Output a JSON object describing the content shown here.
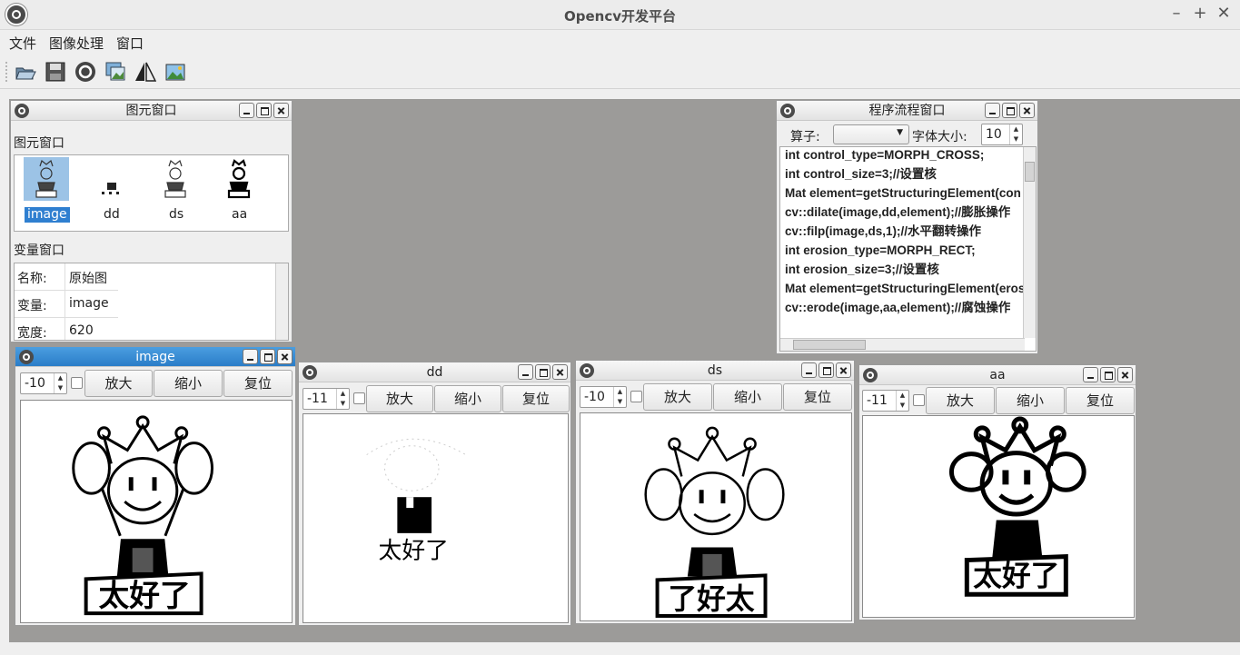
{
  "window": {
    "title": "Opencv开发平台",
    "controls": [
      "–",
      "+",
      "✕"
    ]
  },
  "menu": [
    "文件",
    "图像处理",
    "窗口"
  ],
  "toolbar": [
    "open-icon",
    "save-icon",
    "opencv-icon",
    "image-icon",
    "flip-icon",
    "picture-icon"
  ],
  "element_window": {
    "title": "图元窗口",
    "section_label": "图元窗口",
    "items": [
      {
        "label": "image",
        "selected": true
      },
      {
        "label": "dd",
        "selected": false
      },
      {
        "label": "ds",
        "selected": false
      },
      {
        "label": "aa",
        "selected": false
      }
    ],
    "var_label": "变量窗口",
    "vars": [
      {
        "key": "名称:",
        "value": "原始图"
      },
      {
        "key": "变量:",
        "value": "image"
      },
      {
        "key": "宽度:",
        "value": "620"
      }
    ]
  },
  "flow_window": {
    "title": "程序流程窗口",
    "operator_label": "算子:",
    "operator_value": "",
    "font_size_label": "字体大小:",
    "font_size_value": "10",
    "lines": [
      "int control_type=MORPH_CROSS;",
      "int control_size=3;//设置核",
      "Mat element=getStructuringElement(con",
      "cv::dilate(image,dd,element);//膨胀操作",
      "cv::filp(image,ds,1);//水平翻转操作",
      "int erosion_type=MORPH_RECT;",
      "int erosion_size=3;//设置核",
      "Mat element=getStructuringElement(eros",
      "cv::erode(image,aa,element);//腐蚀操作"
    ]
  },
  "image_windows": [
    {
      "title": "image",
      "zoom": "-10",
      "zoom_in": "放大",
      "zoom_out": "缩小",
      "reset": "复位",
      "caption": "太好了"
    },
    {
      "title": "dd",
      "zoom": "-11",
      "zoom_in": "放大",
      "zoom_out": "缩小",
      "reset": "复位",
      "caption": "太好了"
    },
    {
      "title": "ds",
      "zoom": "-10",
      "zoom_in": "放大",
      "zoom_out": "缩小",
      "reset": "复位",
      "caption": "了好太"
    },
    {
      "title": "aa",
      "zoom": "-11",
      "zoom_in": "放大",
      "zoom_out": "缩小",
      "reset": "复位",
      "caption": "太好了"
    }
  ]
}
